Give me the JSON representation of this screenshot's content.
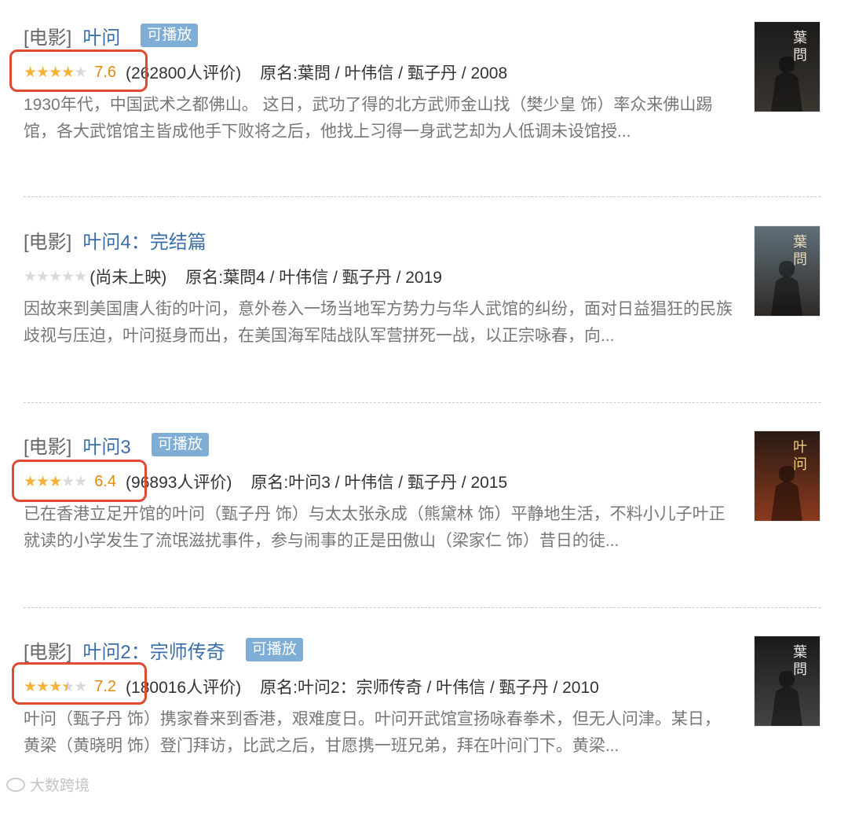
{
  "results": [
    {
      "category": "[电影]",
      "title": "叶问",
      "playable": "可播放",
      "stars": 4,
      "half": false,
      "score": "7.6",
      "count": "(262800人评价)",
      "meta": "原名:葉問 / 叶伟信 / 甄子丹 / 2008",
      "desc": "1930年代，中国武术之都佛山。 这日，武功了得的北方武师金山找（樊少皇 饰）率众来佛山踢馆，各大武馆馆主皆成他手下败将之后，他找上习得一身武艺却为人低调未设馆授...",
      "poster_title": "葉問"
    },
    {
      "category": "[电影]",
      "title": "叶问4：完结篇",
      "playable": "",
      "stars": 0,
      "half": false,
      "score": "",
      "count": "(尚未上映)",
      "meta": "原名:葉問4 / 叶伟信 / 甄子丹 / 2019",
      "desc": "因故来到美国唐人街的叶问，意外卷入一场当地军方势力与华人武馆的纠纷，面对日益猖狂的民族歧视与压迫，叶问挺身而出，在美国海军陆战队军营拼死一战，以正宗咏春，向...",
      "poster_title": "葉問"
    },
    {
      "category": "[电影]",
      "title": "叶问3",
      "playable": "可播放",
      "stars": 3,
      "half": false,
      "score": "6.4",
      "count": "(96893人评价)",
      "meta": "原名:叶问3 / 叶伟信 / 甄子丹 / 2015",
      "desc": "已在香港立足开馆的叶问（甄子丹 饰）与太太张永成（熊黛林 饰）平静地生活，不料小儿子叶正就读的小学发生了流氓滋扰事件，参与闹事的正是田傲山（梁家仁 饰）昔日的徒...",
      "poster_title": "叶问"
    },
    {
      "category": "[电影]",
      "title": "叶问2：宗师传奇",
      "playable": "可播放",
      "stars": 3,
      "half": true,
      "score": "7.2",
      "count": "(180016人评价)",
      "meta": "原名:叶问2：宗师传奇 / 叶伟信 / 甄子丹 / 2010",
      "desc": "叶问（甄子丹 饰）携家眷来到香港，艰难度日。叶问开武馆宣扬咏春拳术，但无人问津。某日，黄梁（黄晓明 饰）登门拜访，比武之后，甘愿携一班兄弟，拜在叶问门下。黄梁...",
      "poster_title": "葉問"
    }
  ],
  "watermark": "大数跨境",
  "colors": {
    "title_link": "#3b6ea8",
    "star": "#f5b23a",
    "score": "#e08a10",
    "playable_bg": "#7eaed6",
    "highlight": "#e04a33"
  }
}
